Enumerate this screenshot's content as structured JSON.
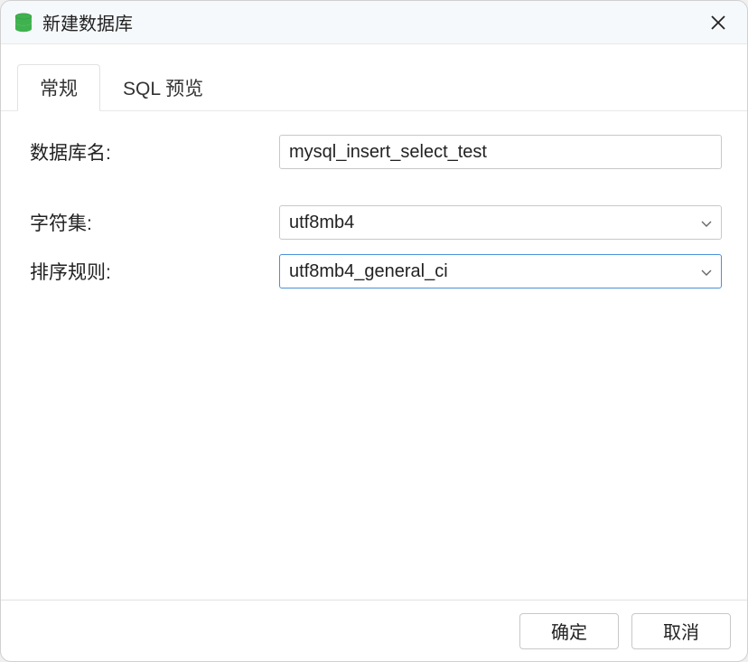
{
  "titlebar": {
    "title": "新建数据库"
  },
  "tabs": [
    {
      "label": "常规",
      "active": true
    },
    {
      "label": "SQL 预览",
      "active": false
    }
  ],
  "form": {
    "database_name": {
      "label": "数据库名:",
      "value": "mysql_insert_select_test"
    },
    "charset": {
      "label": "字符集:",
      "value": "utf8mb4"
    },
    "collation": {
      "label": "排序规则:",
      "value": "utf8mb4_general_ci"
    }
  },
  "footer": {
    "ok_label": "确定",
    "cancel_label": "取消"
  }
}
